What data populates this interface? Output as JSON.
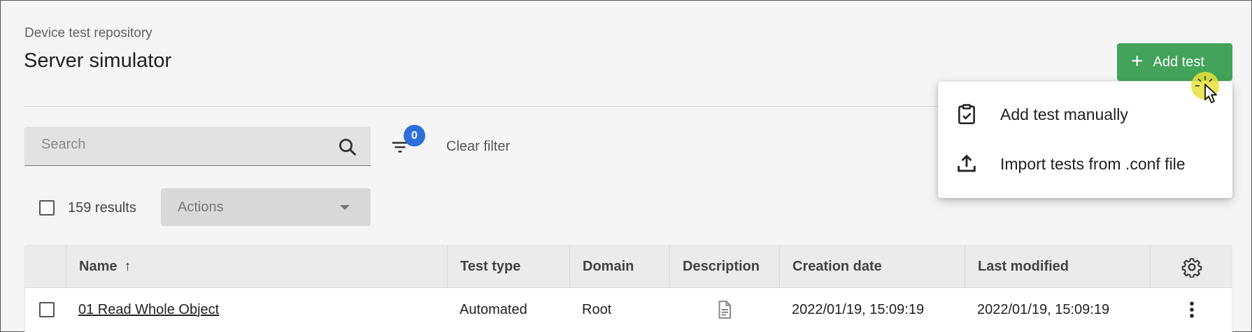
{
  "header": {
    "breadcrumb": "Device test repository",
    "title": "Server simulator",
    "add_button_label": "Add test"
  },
  "add_menu": {
    "items": [
      {
        "label": "Add test manually",
        "icon": "clipboard-check-icon"
      },
      {
        "label": "Import tests from .conf file",
        "icon": "upload-icon"
      }
    ]
  },
  "toolbar": {
    "search_placeholder": "Search",
    "filter_count": "0",
    "clear_filter_label": "Clear filter",
    "results_label": "159 results",
    "actions_label": "Actions"
  },
  "table": {
    "columns": [
      "Name",
      "Test type",
      "Domain",
      "Description",
      "Creation date",
      "Last modified"
    ],
    "rows": [
      {
        "name": "01 Read Whole Object",
        "test_type": "Automated",
        "domain": "Root",
        "description_icon": "document-icon",
        "creation_date": "2022/01/19, 15:09:19",
        "last_modified": "2022/01/19, 15:09:19"
      }
    ]
  },
  "colors": {
    "primary_green": "#43a35a",
    "badge_blue": "#2f6fdc",
    "background": "#f5f5f5"
  }
}
